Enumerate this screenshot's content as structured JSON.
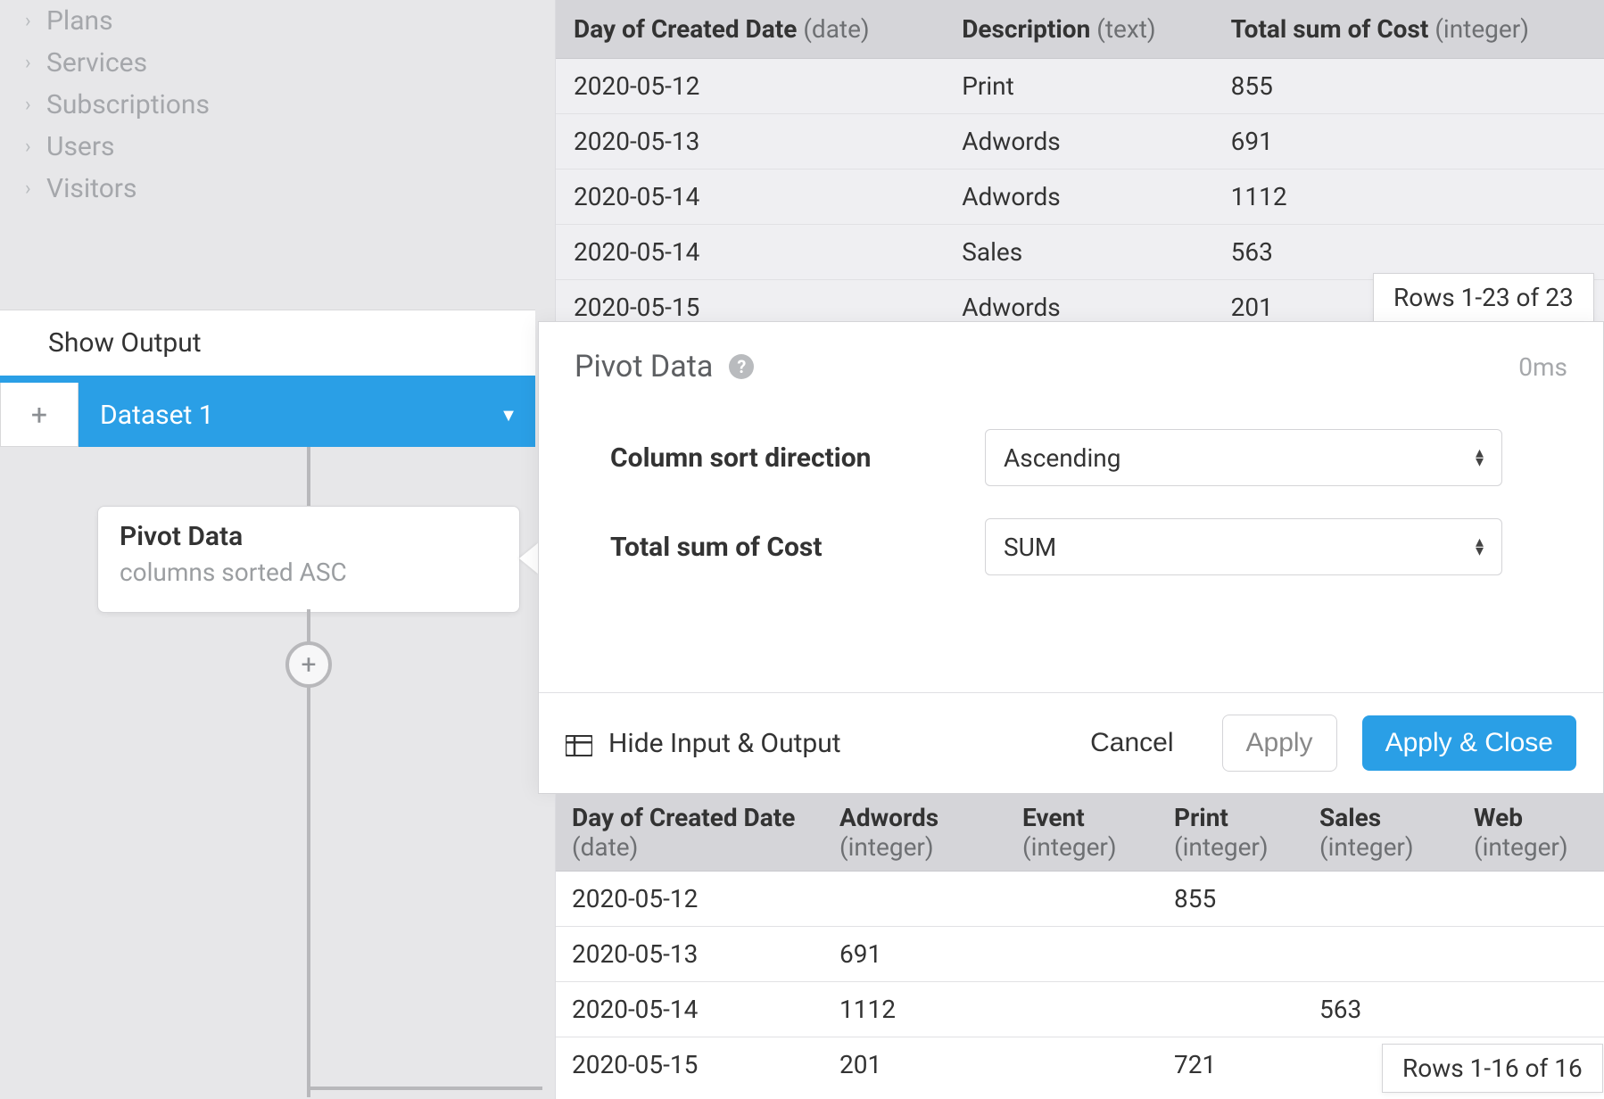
{
  "sidebar": {
    "items": [
      {
        "label": "Plans"
      },
      {
        "label": "Services"
      },
      {
        "label": "Subscriptions"
      },
      {
        "label": "Users"
      },
      {
        "label": "Visitors"
      }
    ],
    "show_output": "Show Output",
    "dataset_label": "Dataset 1"
  },
  "node": {
    "title": "Pivot Data",
    "subtitle": "columns sorted ASC"
  },
  "input_table": {
    "columns": [
      {
        "name": "Day of Created Date",
        "type": "(date)"
      },
      {
        "name": "Description",
        "type": "(text)"
      },
      {
        "name": "Total sum of Cost",
        "type": "(integer)"
      }
    ],
    "rows": [
      [
        "2020-05-12",
        "Print",
        "855"
      ],
      [
        "2020-05-13",
        "Adwords",
        "691"
      ],
      [
        "2020-05-14",
        "Adwords",
        "1112"
      ],
      [
        "2020-05-14",
        "Sales",
        "563"
      ],
      [
        "2020-05-15",
        "Adwords",
        "201"
      ]
    ],
    "rows_badge": "Rows 1-23 of 23"
  },
  "panel": {
    "title": "Pivot Data",
    "timing": "0ms",
    "fields": {
      "sort_label": "Column sort direction",
      "sort_value": "Ascending",
      "agg_label": "Total sum of Cost",
      "agg_value": "SUM"
    },
    "hide_io": "Hide Input & Output",
    "cancel": "Cancel",
    "apply": "Apply",
    "apply_close": "Apply & Close"
  },
  "output_table": {
    "columns": [
      {
        "name": "Day of Created Date",
        "type": "(date)"
      },
      {
        "name": "Adwords",
        "type": "(integer)"
      },
      {
        "name": "Event",
        "type": "(integer)"
      },
      {
        "name": "Print",
        "type": "(integer)"
      },
      {
        "name": "Sales",
        "type": "(integer)"
      },
      {
        "name": "Web",
        "type": "(integer)"
      }
    ],
    "rows": [
      [
        "2020-05-12",
        "",
        "",
        "855",
        "",
        ""
      ],
      [
        "2020-05-13",
        "691",
        "",
        "",
        "",
        ""
      ],
      [
        "2020-05-14",
        "1112",
        "",
        "",
        "563",
        ""
      ],
      [
        "2020-05-15",
        "201",
        "",
        "721",
        "",
        ""
      ]
    ],
    "rows_badge": "Rows 1-16 of 16"
  }
}
